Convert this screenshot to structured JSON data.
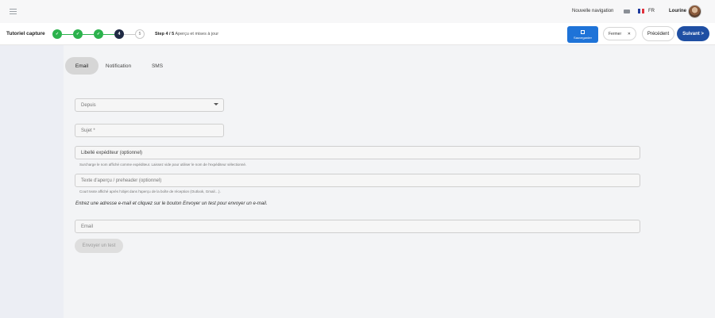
{
  "topnav": {
    "new_nav_label": "Nouvelle navigation",
    "language": "FR",
    "username": "Lourine",
    "flag_colors": [
      "#1f3c9e",
      "#ffffff",
      "#e0323c"
    ]
  },
  "tutorial": {
    "title": "Tutoriel capture",
    "steps": [
      {
        "state": "done",
        "label": "✓"
      },
      {
        "state": "done",
        "label": "✓"
      },
      {
        "state": "done",
        "label": "✓"
      },
      {
        "state": "current",
        "label": "4"
      },
      {
        "state": "todo",
        "label": "5"
      }
    ],
    "step_prefix": "Step 4 / 5",
    "step_text": "Aperçu et mises à jour",
    "save_label": "Sauvegarder",
    "close_label": "Fermer",
    "prev_label": "Précédent",
    "next_label": "Suivant >"
  },
  "tabs": [
    "Email",
    "Notification",
    "SMS"
  ],
  "form": {
    "from_placeholder": "Depuis",
    "subject_placeholder": "Sujet *",
    "sender_label_placeholder": "Libellé expéditeur (optionnel)",
    "sender_hint": "Surcharge le nom affiché comme expéditeur. Laissez vide pour utiliser le nom de l'expéditeur sélectionné.",
    "preheader_placeholder": "Texte d'aperçu / preheader (optionnel)",
    "preheader_hint": "Court texte affiché après l'objet dans l'aperçu de la boîte de réception (Outlook, Gmail…).",
    "instruction": "Entrez une adresse e-mail et cliquez sur le bouton Envoyer un test pour envoyer un e-mail.",
    "email_placeholder": "Email",
    "send_test_label": "Envoyer un test"
  },
  "colors": {
    "accent_blue": "#1e73d8",
    "next_blue": "#1f4fa3",
    "step_done": "#2bb24c",
    "step_current": "#1f2a44"
  }
}
